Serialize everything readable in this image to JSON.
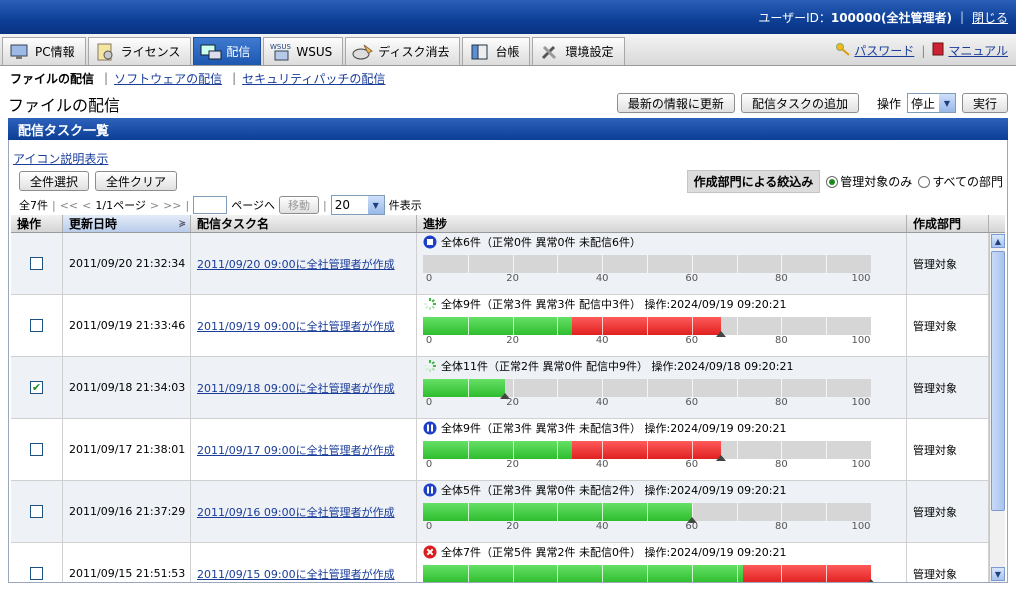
{
  "header": {
    "user_label": "ユーザーID：",
    "user_id": "100000(全社管理者)",
    "logout": "閉じる"
  },
  "tabs": [
    {
      "label": "PC情報",
      "icon": "pc-icon"
    },
    {
      "label": "ライセンス",
      "icon": "license-icon"
    },
    {
      "label": "配信",
      "icon": "distribution-icon",
      "active": true
    },
    {
      "label": "WSUS",
      "icon": "wsus-icon",
      "badge": "WSUS"
    },
    {
      "label": "ディスク消去",
      "icon": "disk-erase-icon"
    },
    {
      "label": "台帳",
      "icon": "ledger-icon"
    },
    {
      "label": "環境設定",
      "icon": "settings-icon"
    }
  ],
  "tools": {
    "password": "パスワード",
    "manual": "マニュアル"
  },
  "subnav": {
    "current": "ファイルの配信",
    "software": "ソフトウェアの配信",
    "security": "セキュリティパッチの配信"
  },
  "page": {
    "title": "ファイルの配信",
    "refresh": "最新の情報に更新",
    "add_task": "配信タスクの追加",
    "op_label": "操作",
    "op_value": "停止",
    "execute": "実行"
  },
  "section": {
    "title": "配信タスク一覧"
  },
  "controls": {
    "icon_legend": "アイコン説明表示",
    "select_all": "全件選択",
    "clear_all": "全件クリア"
  },
  "filter": {
    "label": "作成部門による絞込み",
    "opt1": "管理対象のみ",
    "opt2": "すべての部門",
    "selected": "opt1"
  },
  "pager": {
    "total": "全7件",
    "first": "<<",
    "prev": "<",
    "pages": "1/1ページ",
    "next": ">",
    "last": ">>",
    "to_page": "ページへ",
    "move": "移動",
    "per_page": "20",
    "per_page_suffix": "件表示"
  },
  "columns": {
    "op": "操作",
    "updated": "更新日時",
    "task": "配信タスク名",
    "progress": "進捗",
    "dept": "作成部門"
  },
  "scale_labels": [
    "0",
    "20",
    "40",
    "60",
    "80",
    "100"
  ],
  "rows": [
    {
      "checked": false,
      "updated": "2011/09/20 21:32:34",
      "task": "2011/09/20 09:00に全社管理者が作成",
      "status": "stopped",
      "summary": "全体6件（正常0件 異常0件 未配信6件）",
      "green": 0,
      "red": 0,
      "dept": "管理対象"
    },
    {
      "checked": false,
      "updated": "2011/09/19 21:33:46",
      "task": "2011/09/19 09:00に全社管理者が作成",
      "status": "running",
      "summary": "全体9件（正常3件 異常3件 配信中3件） 操作:2024/09/19 09:20:21",
      "green": 33.3,
      "red": 33.3,
      "dept": "管理対象"
    },
    {
      "checked": true,
      "updated": "2011/09/18 21:34:03",
      "task": "2011/09/18 09:00に全社管理者が作成",
      "status": "running",
      "summary": "全体11件（正常2件 異常0件 配信中9件） 操作:2024/09/18 09:20:21",
      "green": 18.2,
      "red": 0,
      "dept": "管理対象"
    },
    {
      "checked": false,
      "updated": "2011/09/17 21:38:01",
      "task": "2011/09/17 09:00に全社管理者が作成",
      "status": "paused",
      "summary": "全体9件（正常3件 異常3件 未配信3件） 操作:2024/09/19 09:20:21",
      "green": 33.3,
      "red": 33.3,
      "dept": "管理対象"
    },
    {
      "checked": false,
      "updated": "2011/09/16 21:37:29",
      "task": "2011/09/16 09:00に全社管理者が作成",
      "status": "paused",
      "summary": "全体5件（正常3件 異常0件 未配信2件） 操作:2024/09/19 09:20:21",
      "green": 60,
      "red": 0,
      "dept": "管理対象"
    },
    {
      "checked": false,
      "updated": "2011/09/15 21:51:53",
      "task": "2011/09/15 09:00に全社管理者が作成",
      "status": "error",
      "summary": "全体7件（正常5件 異常2件 未配信0件） 操作:2024/09/19 09:20:21",
      "green": 71.4,
      "red": 28.6,
      "dept": "管理対象"
    }
  ],
  "colors": {
    "green": "#2ebd2e",
    "red": "#e02020",
    "header_blue": "#0d3f96"
  }
}
